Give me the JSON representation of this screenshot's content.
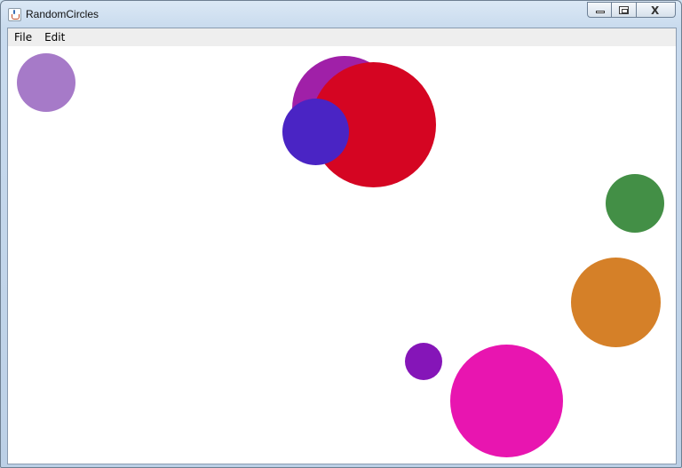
{
  "window": {
    "title": "RandomCircles",
    "minimize_label": "",
    "maximize_label": "",
    "close_label": "X"
  },
  "menubar": {
    "items": [
      {
        "label": "File"
      },
      {
        "label": "Edit"
      }
    ]
  },
  "canvas": {
    "background": "#ffffff",
    "circles": [
      {
        "color": "#a67ac8"
      },
      {
        "color": "#a020a8"
      },
      {
        "color": "#d50522"
      },
      {
        "color": "#4a24c4"
      },
      {
        "color": "#438f46"
      },
      {
        "color": "#d58028"
      },
      {
        "color": "#8515b8"
      },
      {
        "color": "#e815b0"
      }
    ]
  }
}
